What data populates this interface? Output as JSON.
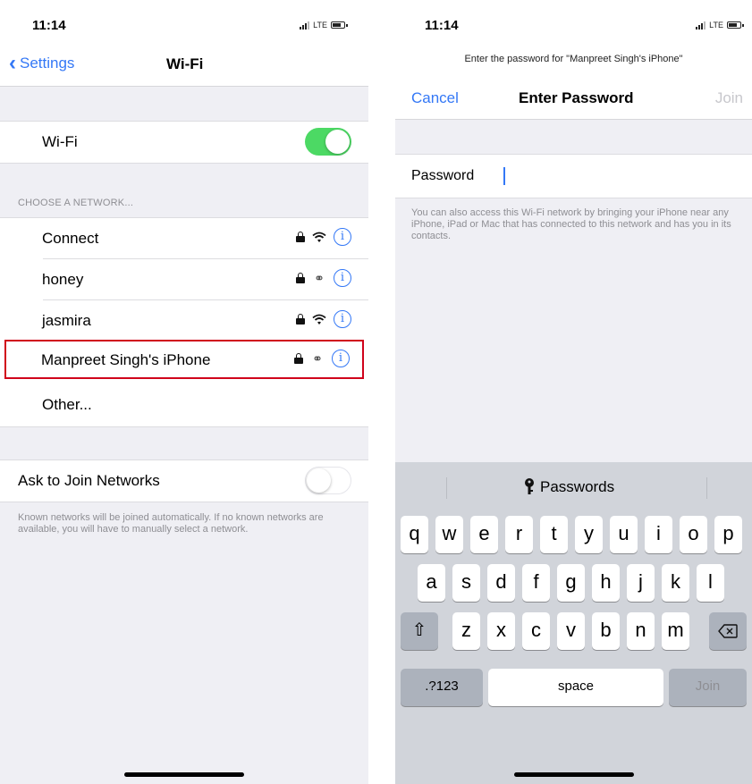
{
  "left": {
    "status": {
      "time": "11:14",
      "carrier": "LTE"
    },
    "nav": {
      "back_label": "Settings",
      "title": "Wi-Fi"
    },
    "wifi": {
      "label": "Wi-Fi",
      "enabled": true
    },
    "section_title": "CHOOSE A NETWORK...",
    "networks": [
      {
        "name": "Connect",
        "icon": "wifi-icon"
      },
      {
        "name": "honey",
        "icon": "personal-hotspot-icon"
      },
      {
        "name": "jasmira",
        "icon": "wifi-icon"
      },
      {
        "name": "Manpreet Singh's iPhone",
        "icon": "personal-hotspot-icon",
        "highlighted": true
      }
    ],
    "other_label": "Other...",
    "ask_join": {
      "label": "Ask to Join Networks",
      "enabled": false
    },
    "ask_join_note": "Known networks will be joined automatically. If no known networks are available, you will have to manually select a network."
  },
  "right": {
    "status": {
      "time": "11:14",
      "carrier": "LTE"
    },
    "prompt": "Enter the password for \"Manpreet Singh's iPhone\"",
    "nav": {
      "cancel_label": "Cancel",
      "title": "Enter Password",
      "join_label": "Join"
    },
    "password": {
      "label": "Password",
      "value": ""
    },
    "note": "You can also access this Wi-Fi network by bringing your iPhone near any iPhone, iPad or Mac that has connected to this network and has you in its contacts.",
    "keyboard": {
      "suggestion": "Passwords",
      "row1": [
        "q",
        "w",
        "e",
        "r",
        "t",
        "y",
        "u",
        "i",
        "o",
        "p"
      ],
      "row2": [
        "a",
        "s",
        "d",
        "f",
        "g",
        "h",
        "j",
        "k",
        "l"
      ],
      "row3": [
        "z",
        "x",
        "c",
        "v",
        "b",
        "n",
        "m"
      ],
      "numbers_label": ".?123",
      "space_label": "space",
      "join_label": "Join"
    }
  },
  "colors": {
    "accent": "#3478f6",
    "toggle_on": "#4cd964",
    "highlight": "#d0021b",
    "background": "#efeff4"
  }
}
